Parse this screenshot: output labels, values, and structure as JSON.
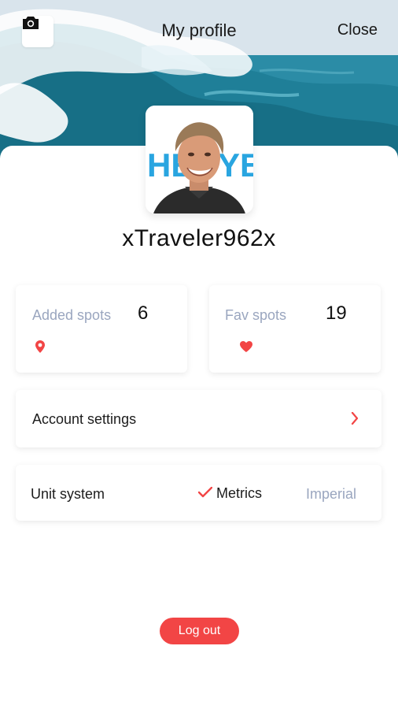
{
  "header": {
    "title": "My profile",
    "close_label": "Close",
    "camera_icon": "camera-icon"
  },
  "profile": {
    "username": "xTraveler962x",
    "avatar_icon": "profile-photo"
  },
  "stats": {
    "added": {
      "label": "Added spots",
      "value": "6",
      "icon": "map-pin-icon"
    },
    "fav": {
      "label": "Fav spots",
      "value": "19",
      "icon": "heart-icon"
    }
  },
  "settings": {
    "account_label": "Account settings",
    "chevron_icon": "chevron-right-icon"
  },
  "units": {
    "label": "Unit system",
    "metric_label": "Metrics",
    "imperial_label": "Imperial",
    "selected": "Metrics",
    "check_icon": "check-icon"
  },
  "actions": {
    "logout_label": "Log out"
  },
  "colors": {
    "accent": "#f24545",
    "muted": "#9aa6bf",
    "text": "#1c1c1c"
  }
}
